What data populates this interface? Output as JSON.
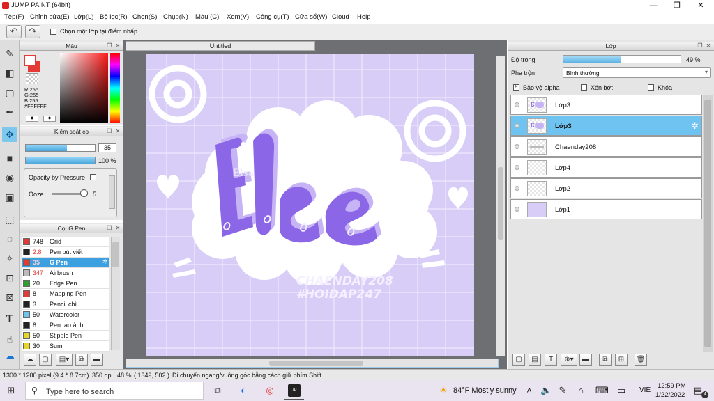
{
  "window": {
    "title": "JUMP PAINT (64bit)",
    "minimize": "—",
    "maximize": "❐",
    "close": "✕"
  },
  "menu": [
    "Tệp(F)",
    "Chỉnh sửa(E)",
    "Lớp(L)",
    "Bộ lọc(R)",
    "Chọn(S)",
    "Chụp(N)",
    "Màu (C)",
    "Xem(V)",
    "Công cụ(T)",
    "Cửa sổ(W)",
    "Cloud",
    "Help"
  ],
  "toolbar": {
    "undo": "↶",
    "redo": "↷",
    "select_layer_label": "Chọn một lớp tại điểm nhấp"
  },
  "color_panel": {
    "title": "Màu",
    "r": "R:255",
    "g": "G:255",
    "b": "B:255",
    "hex": "#FFFFFF",
    "primary": "#e53935",
    "secondary": "#ffffff"
  },
  "brush_control": {
    "title": "Kiểm soát cọ",
    "size_value": "35",
    "size_fill": 0.6,
    "opacity_value": "100 %",
    "opacity_fill": 1.0,
    "opacity_by_pressure": "Opacity by Pressure",
    "ooze_label": "Ooze",
    "ooze_value": "5"
  },
  "brush_list": {
    "title": "Cọ: G Pen",
    "items": [
      {
        "size": "748",
        "name": "Grid",
        "color": "#e53935"
      },
      {
        "size": "2.8",
        "name": "Pen bút viết",
        "color": "#222222",
        "red": true
      },
      {
        "size": "35",
        "name": "G Pen",
        "color": "#e53935",
        "selected": true,
        "red": true
      },
      {
        "size": "347",
        "name": "Airbrush",
        "color": "#bbbbbb",
        "red": true
      },
      {
        "size": "20",
        "name": "Edge Pen",
        "color": "#2ca02c"
      },
      {
        "size": "8",
        "name": "Mapping Pen",
        "color": "#e53935"
      },
      {
        "size": "3",
        "name": "Pencil chì",
        "color": "#222222"
      },
      {
        "size": "50",
        "name": "Watercolor",
        "color": "#6ec6f0"
      },
      {
        "size": "8",
        "name": "Pen tạo ảnh",
        "color": "#222222"
      },
      {
        "size": "50",
        "name": "Stipple Pen",
        "color": "#e5d52c"
      },
      {
        "size": "30",
        "name": "Sumi",
        "color": "#e5d52c"
      }
    ]
  },
  "document": {
    "tab": "Untitled",
    "art_title": "Elsa",
    "watermark_1": "CHAENDAY208",
    "watermark_2": "#HOIDAP247"
  },
  "layers_panel": {
    "title": "Lớp",
    "opacity_label": "Độ trong",
    "opacity_value": "49 %",
    "opacity_fill": 0.49,
    "blend_label": "Pha trộn",
    "blend_value": "Bình thường",
    "protect_alpha": "Bảo vệ alpha",
    "clipping": "Xén bớt",
    "lock": "Khóa",
    "layers": [
      {
        "name": "Lớp3",
        "thumb": "logo"
      },
      {
        "name": "Lớp3",
        "thumb": "logo",
        "selected": true
      },
      {
        "name": "Chaenday208",
        "thumb": "text"
      },
      {
        "name": "Lớp4",
        "thumb": "empty"
      },
      {
        "name": "Lớp2",
        "thumb": "empty"
      },
      {
        "name": "Lớp1",
        "thumb": "fill"
      }
    ]
  },
  "status": {
    "pixels": "1300 * 1200 pixel",
    "size": "(9.4 * 8.7cm)",
    "dpi": "350 dpi",
    "zoom": "48 %",
    "coords": "( 1349, 502 )",
    "hint": "Di chuyển ngang/vuông góc bằng cách giữ phím Shift"
  },
  "taskbar": {
    "search_placeholder": "Type here to search",
    "weather": "84°F  Mostly sunny",
    "lang": "VIE",
    "time": "12:59 PM",
    "date": "1/22/2022",
    "notif": "4"
  }
}
